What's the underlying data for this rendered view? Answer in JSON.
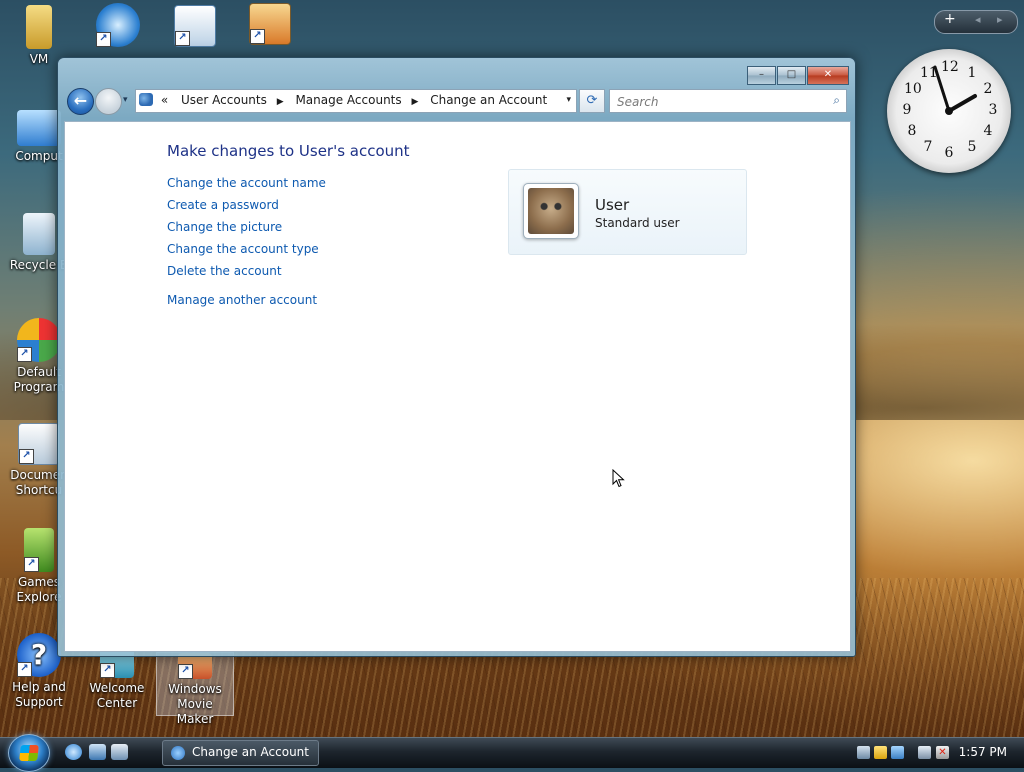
{
  "desktop": {
    "icons": [
      {
        "label": "VM",
        "icon": "folder-icon",
        "color": "#d9b54a"
      },
      {
        "label": "",
        "icon": "internet-explorer-icon",
        "color": "#2b7fd0"
      },
      {
        "label": "",
        "icon": "calendar-icon",
        "color": "#5a92c8"
      },
      {
        "label": "",
        "icon": "photo-gallery-icon",
        "color": "#e3872b"
      },
      {
        "label": "Comput",
        "icon": "computer-icon",
        "color": "#4a8fd8"
      },
      {
        "label": "Recycle B",
        "icon": "recycle-bin-icon",
        "color": "#9bb8cf"
      },
      {
        "label": "Default Program",
        "icon": "default-programs-icon",
        "color": "#4aa84a"
      },
      {
        "label": "Documen Shortcu",
        "icon": "documents-icon",
        "color": "#8aa6c1"
      },
      {
        "label": "Games Explore",
        "icon": "games-icon",
        "color": "#67a63a"
      },
      {
        "label": "Help and Support",
        "icon": "help-icon",
        "color": "#2a6fd3"
      },
      {
        "label": "Welcome Center",
        "icon": "welcome-center-icon",
        "color": "#3ba7c9"
      },
      {
        "label": "Windows Movie Maker",
        "icon": "movie-maker-icon",
        "color": "#d05a2a"
      }
    ]
  },
  "sidebar": {
    "add_label": "+",
    "prev_label": "◂",
    "next_label": "▸"
  },
  "clock": {
    "numerals": [
      "12",
      "1",
      "2",
      "3",
      "4",
      "5",
      "6",
      "7",
      "8",
      "9",
      "10",
      "11"
    ],
    "time": "1:57"
  },
  "window": {
    "controls": {
      "minimize": "–",
      "maximize": "□",
      "close": "✕"
    },
    "nav": {
      "back": "←",
      "dropdown": "▾"
    },
    "address": {
      "overflow": "«",
      "crumbs": [
        "User Accounts",
        "Manage Accounts",
        "Change an Account"
      ],
      "separator": "▶",
      "dropdown": "▾"
    },
    "refresh": "⟳",
    "search": {
      "placeholder": "Search",
      "icon": "⌕"
    },
    "heading": "Make changes to User's account",
    "tasks": [
      "Change the account name",
      "Create a password",
      "Change the picture",
      "Change the account type",
      "Delete the account"
    ],
    "other_task": "Manage another account",
    "user": {
      "name": "User",
      "type": "Standard user"
    }
  },
  "taskbar": {
    "active_window": "Change an Account",
    "time": "1:57 PM",
    "colors": {
      "accent": "#1e3287",
      "link": "#0e5ab0"
    }
  }
}
